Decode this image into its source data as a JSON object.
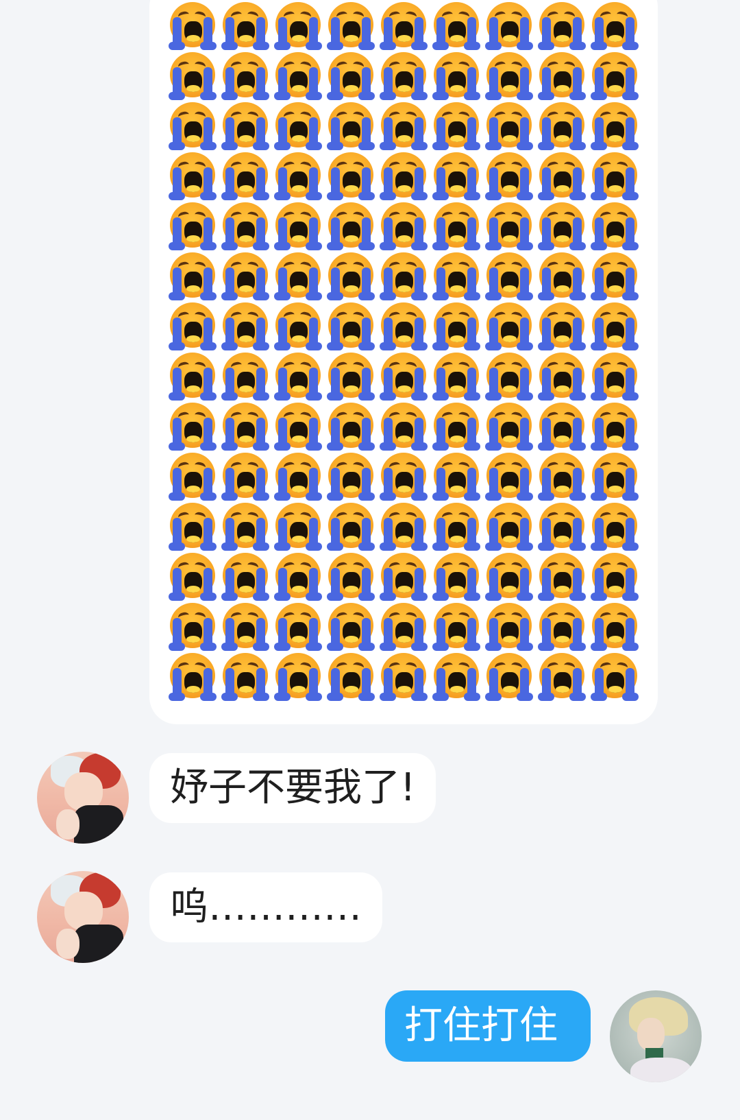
{
  "conversation": {
    "messages": [
      {
        "sender": "other",
        "type": "emoji-grid",
        "emoji": "loudly-crying-face-icon",
        "columns": 9,
        "rows": 15,
        "count": 135
      },
      {
        "sender": "other",
        "type": "text",
        "text": "妤子不要我了!"
      },
      {
        "sender": "other",
        "type": "text",
        "text": "呜…………"
      },
      {
        "sender": "me",
        "type": "text",
        "text": "打住打住"
      }
    ]
  },
  "colors": {
    "background": "#f3f5f8",
    "incoming_bubble": "#ffffff",
    "outgoing_bubble": "#2aa8f6",
    "tear": "#4a67e0",
    "face": "#f9a825"
  }
}
